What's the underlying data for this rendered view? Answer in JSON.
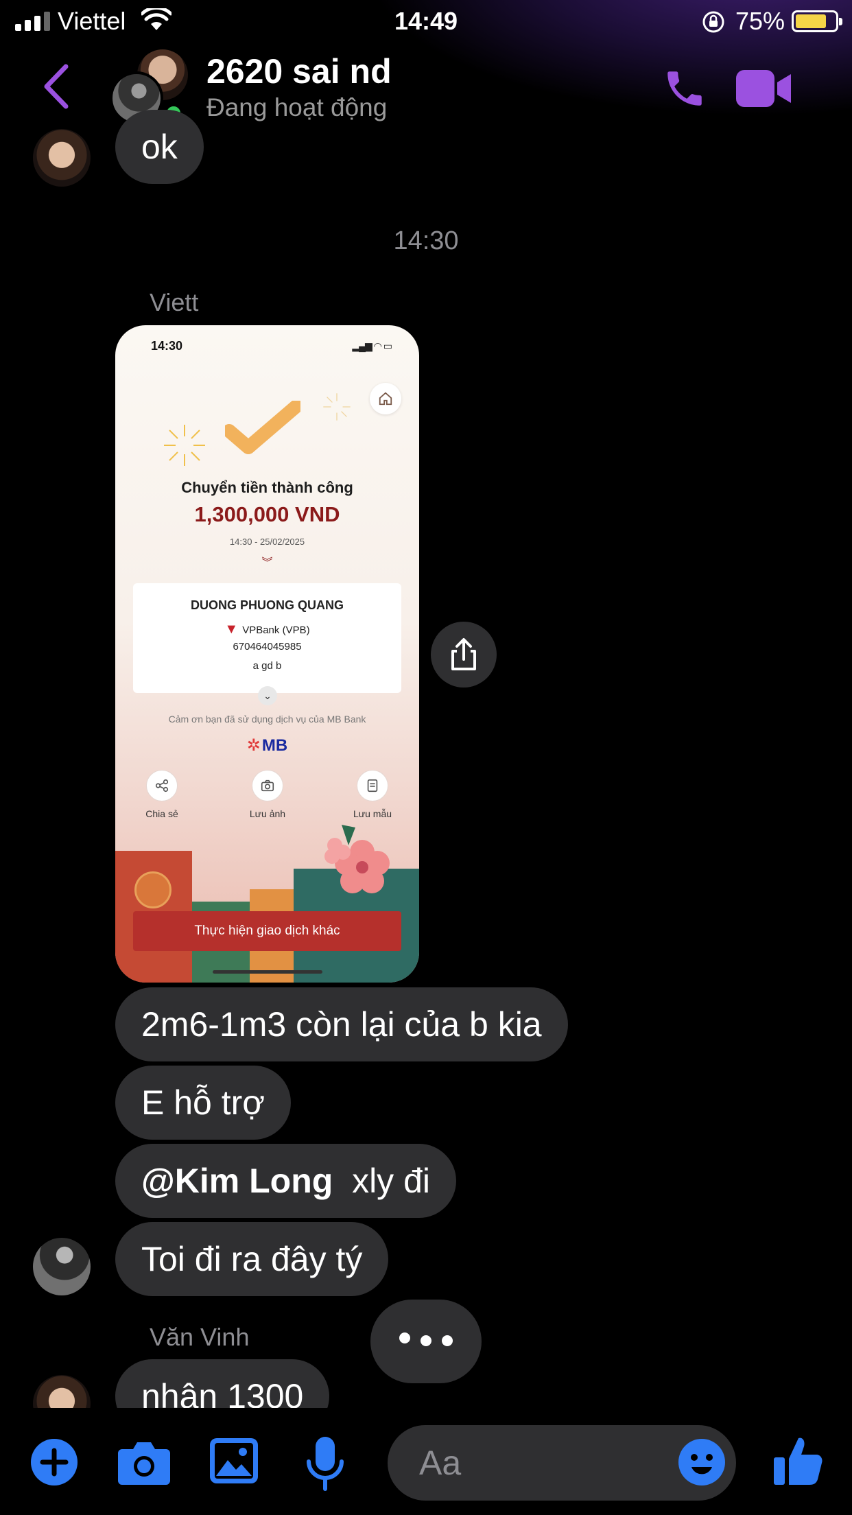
{
  "status_bar": {
    "carrier": "Viettel",
    "time": "14:49",
    "battery": "75%"
  },
  "header": {
    "name": "2620 sai nd",
    "status": "Đang hoạt động"
  },
  "timestamp": "14:30",
  "messages": {
    "ok": "ok",
    "sender_viett": "Viett",
    "m1": "2m6-1m3 còn lại của b kia",
    "m2": "E hỗ trợ",
    "m3_mention": "@Kim Long",
    "m3_rest": "xly đi",
    "m4": "Toi đi ra đây tý",
    "sender_vinh": "Văn Vinh",
    "m5": "nhân 1300"
  },
  "receipt": {
    "time": "14:30",
    "title": "Chuyển tiền thành công",
    "amount": "1,300,000 VND",
    "datetime": "14:30 - 25/02/2025",
    "recipient_name": "DUONG PHUONG QUANG",
    "bank": "VPBank (VPB)",
    "account": "670464045985",
    "memo": "a gd b",
    "thanks": "Cảm ơn bạn đã sử dụng dịch vụ của MB Bank",
    "brand": "MB",
    "actions": [
      "Chia sẻ",
      "Lưu ảnh",
      "Lưu mẫu"
    ],
    "button": "Thực hiện giao dịch khác"
  },
  "composer": {
    "placeholder": "Aa"
  },
  "colors": {
    "accent_purple": "#9b51e0",
    "accent_blue": "#2f7cf6",
    "bubble": "#2f2f31",
    "online": "#34c759"
  }
}
